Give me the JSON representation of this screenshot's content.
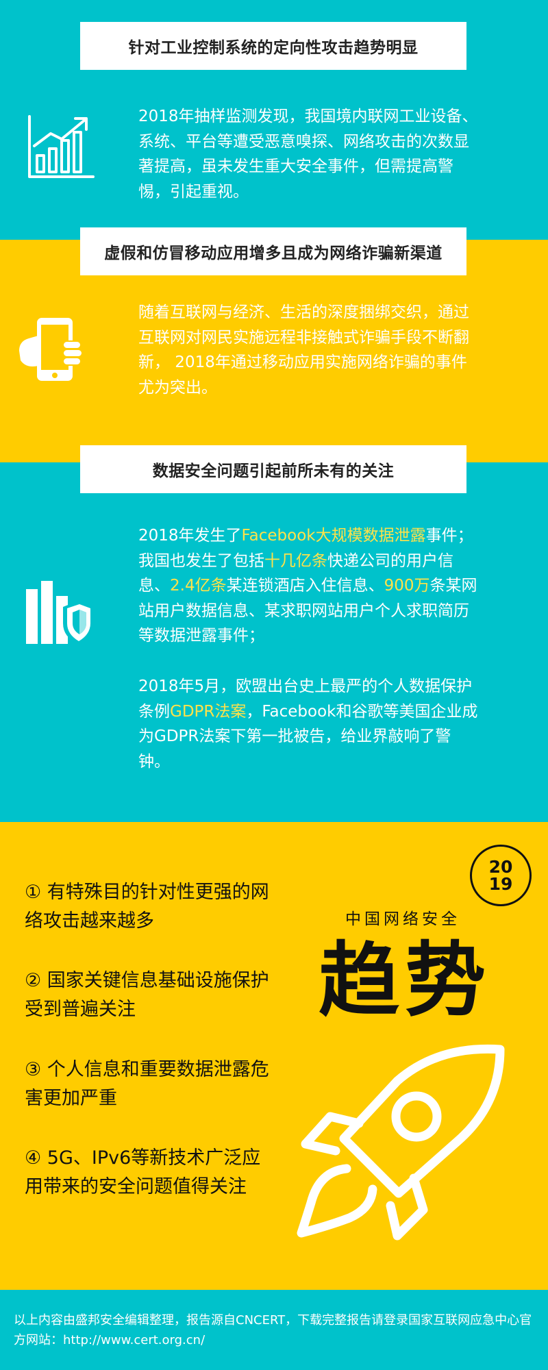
{
  "section1": {
    "title": "针对工业控制系统的定向性攻击趋势明显",
    "body": "2018年抽样监测发现，我国境内联网工业设备、系统、平台等遭受恶意嗅探、网络攻击的次数显著提高，虽未发生重大安全事件，但需提高警惕，引起重视。",
    "icon": "chart-growth-icon"
  },
  "section2": {
    "title": "虚假和仿冒移动应用增多且成为网络诈骗新渠道",
    "body": "随着互联网与经济、生活的深度捆绑交织，通过互联网对网民实施远程非接触式诈骗手段不断翻新， 2018年通过移动应用实施网络诈骗的事件尤为突出。",
    "icon": "hand-phone-icon"
  },
  "section3": {
    "title": "数据安全问题引起前所未有的关注",
    "p1_parts": [
      "2018年发生了",
      "Facebook大规模数据泄露",
      "事件；我国也发生了包括",
      "十几亿条",
      "快递公司的用户信息、",
      "2.4亿条",
      "某连锁酒店入住信息、",
      "900万",
      "条某网站用户数据信息、某求职网站用户个人求职简历等数据泄露事件；"
    ],
    "p2_parts": [
      "2018年5月，欧盟出台史上最严的个人数据保护条例",
      "GDPR法案",
      "，Facebook和谷歌等美国企业成为GDPR法案下第一批被告，给业界敲响了警钟。"
    ],
    "icon": "data-shield-icon"
  },
  "summary": {
    "items": [
      "① 有特殊目的针对性更强的网络攻击越来越多",
      "② 国家关键信息基础设施保护受到普遍关注",
      "③ 个人信息和重要数据泄露危害更加严重",
      "④ 5G、IPv6等新技术广泛应用带来的安全问题值得关注"
    ],
    "badge_line1": "20",
    "badge_line2": "19",
    "subtitle": "中国网络安全",
    "big_title": "趋势",
    "icon": "rocket-icon"
  },
  "footer": {
    "text": "以上内容由盛邦安全编辑整理，报告源自CNCERT，下载完整报告请登录国家互联网应急中心官方网站：http://www.cert.org.cn/"
  },
  "colors": {
    "teal": "#00c2cb",
    "yellow": "#ffcc00",
    "highlight": "#ffe24a",
    "white": "#ffffff",
    "dark": "#111111"
  }
}
